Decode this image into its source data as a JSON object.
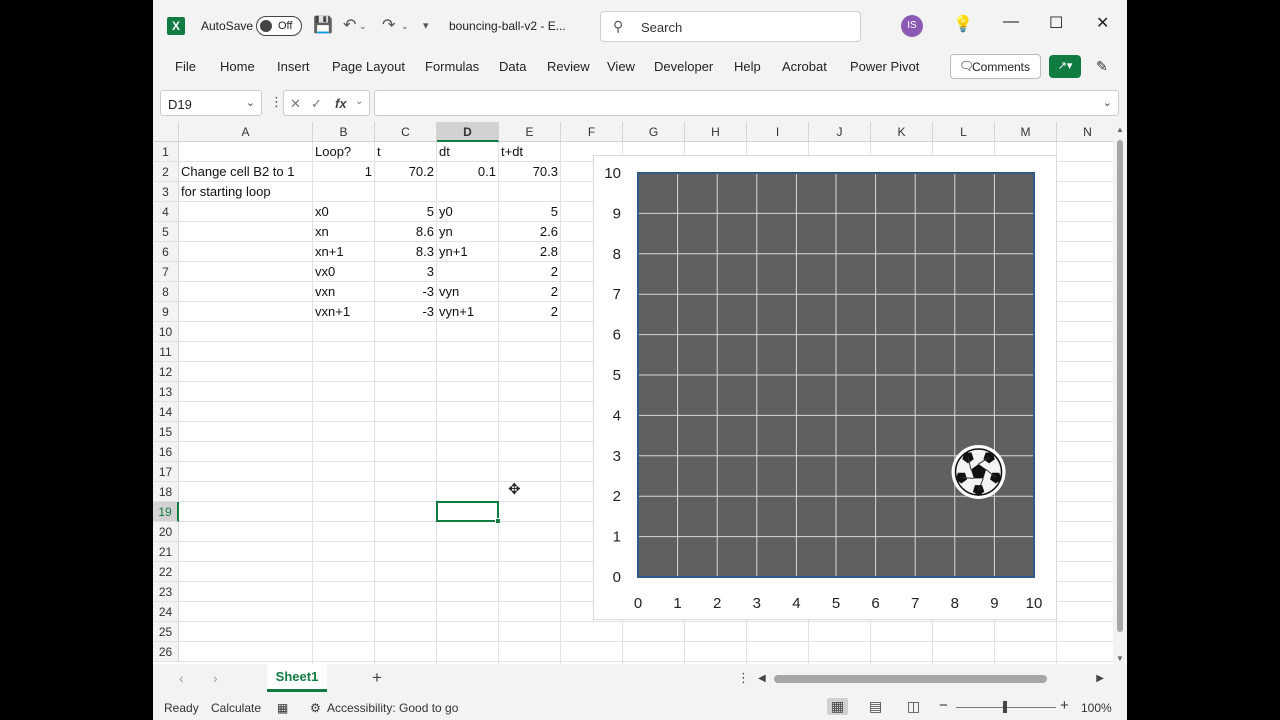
{
  "app": {
    "autosave_label": "AutoSave",
    "autosave_state": "Off",
    "doc_title": "bouncing-ball-v2  -  E...",
    "search_placeholder": "Search",
    "user_initials": "IS",
    "accent_color": "#107c41"
  },
  "menu": {
    "items": [
      "File",
      "Home",
      "Insert",
      "Page Layout",
      "Formulas",
      "Data",
      "Review",
      "View",
      "Developer",
      "Help",
      "Acrobat",
      "Power Pivot"
    ],
    "comments_label": "Comments"
  },
  "formula_bar": {
    "name_box": "D19",
    "fx": "fx",
    "formula": ""
  },
  "grid": {
    "columns": [
      "A",
      "B",
      "C",
      "D",
      "E",
      "F",
      "G",
      "H",
      "I",
      "J",
      "K",
      "L",
      "M",
      "N"
    ],
    "selected_column": "D",
    "rows": [
      "1",
      "2",
      "3",
      "4",
      "5",
      "6",
      "7",
      "8",
      "9",
      "10",
      "11",
      "12",
      "13",
      "14",
      "15",
      "16",
      "17",
      "18",
      "19",
      "20",
      "21",
      "22",
      "23",
      "24",
      "25",
      "26"
    ],
    "selected_row": "19",
    "selected_cell": "D19",
    "cells": {
      "B1": "Loop?",
      "C1": "t",
      "D1": "dt",
      "E1": "t+dt",
      "A2": "Change cell B2 to 1",
      "B2": "1",
      "C2": "70.2",
      "D2": "0.1",
      "E2": "70.3",
      "A3": "for starting loop",
      "B4": "x0",
      "C4": "5",
      "D4": "y0",
      "E4": "5",
      "B5": "xn",
      "C5": "8.6",
      "D5": "yn",
      "E5": "2.6",
      "B6": "xn+1",
      "C6": "8.3",
      "D6": "yn+1",
      "E6": "2.8",
      "B7": "vx0",
      "C7": "3",
      "E7": "2",
      "B8": "vxn",
      "C8": "-3",
      "D8": "vyn",
      "E8": "2",
      "B9": "vxn+1",
      "C9": "-3",
      "D9": "vyn+1",
      "E9": "2"
    }
  },
  "chart_data": {
    "type": "scatter",
    "title": "",
    "xlabel": "",
    "ylabel": "",
    "xlim": [
      0,
      10
    ],
    "ylim": [
      0,
      10
    ],
    "x_ticks": [
      "0",
      "1",
      "2",
      "3",
      "4",
      "5",
      "6",
      "7",
      "8",
      "9",
      "10"
    ],
    "y_ticks": [
      "0",
      "1",
      "2",
      "3",
      "4",
      "5",
      "6",
      "7",
      "8",
      "9",
      "10"
    ],
    "grid": true,
    "plot_background": "#606060",
    "plot_border_color": "#2e5a88",
    "series": [
      {
        "marker": "soccer-ball",
        "points": [
          {
            "x": 8.6,
            "y": 2.6
          }
        ]
      }
    ]
  },
  "sheet_tabs": {
    "tabs": [
      "Sheet1"
    ],
    "active": "Sheet1"
  },
  "status": {
    "ready": "Ready",
    "calculate": "Calculate",
    "accessibility": "Accessibility: Good to go",
    "zoom": "100%"
  }
}
